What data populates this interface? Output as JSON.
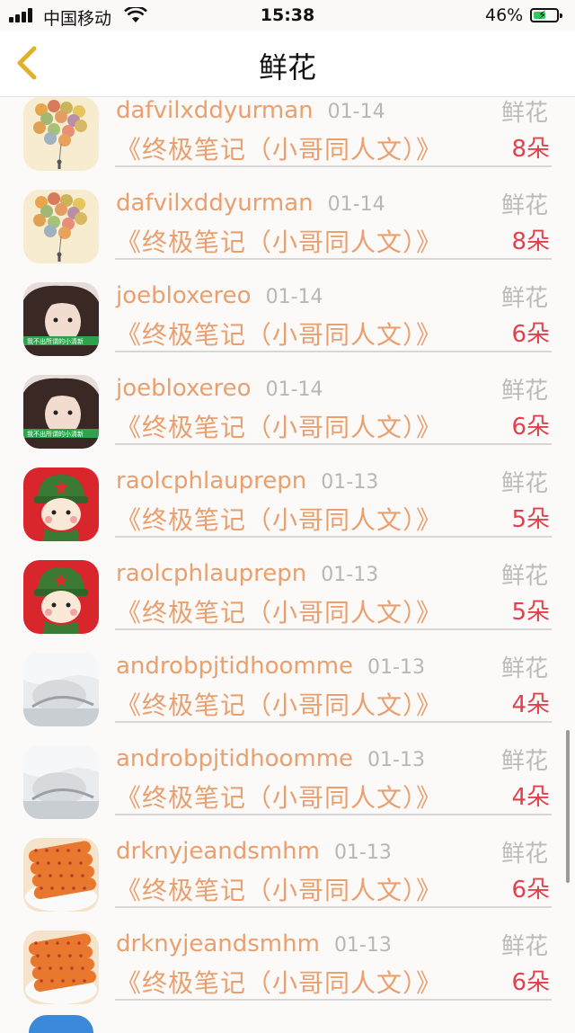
{
  "status_bar": {
    "carrier": "中国移动",
    "time": "15:38",
    "battery_percent": "46%"
  },
  "header": {
    "title": "鲜花"
  },
  "rows": [
    {
      "name": "dafvilxddyurman",
      "date": "01-14",
      "tag": "鲜花",
      "book": "《终极笔记（小哥同人文）》",
      "count": "8朵",
      "avatar": "balloons"
    },
    {
      "name": "dafvilxddyurman",
      "date": "01-14",
      "tag": "鲜花",
      "book": "《终极笔记（小哥同人文）》",
      "count": "8朵",
      "avatar": "balloons"
    },
    {
      "name": "joebloxereo",
      "date": "01-14",
      "tag": "鲜花",
      "book": "《终极笔记（小哥同人文）》",
      "count": "6朵",
      "avatar": "girl"
    },
    {
      "name": "joebloxereo",
      "date": "01-14",
      "tag": "鲜花",
      "book": "《终极笔记（小哥同人文）》",
      "count": "6朵",
      "avatar": "girl"
    },
    {
      "name": "raolcphlauprepn",
      "date": "01-13",
      "tag": "鲜花",
      "book": "《终极笔记（小哥同人文）》",
      "count": "5朵",
      "avatar": "soldier"
    },
    {
      "name": "raolcphlauprepn",
      "date": "01-13",
      "tag": "鲜花",
      "book": "《终极笔记（小哥同人文）》",
      "count": "5朵",
      "avatar": "soldier"
    },
    {
      "name": "androbpjtidhoomme",
      "date": "01-13",
      "tag": "鲜花",
      "book": "《终极笔记（小哥同人文）》",
      "count": "4朵",
      "avatar": "sleeping"
    },
    {
      "name": "androbpjtidhoomme",
      "date": "01-13",
      "tag": "鲜花",
      "book": "《终极笔记（小哥同人文）》",
      "count": "4朵",
      "avatar": "sleeping"
    },
    {
      "name": "drknyjeandsmhm",
      "date": "01-13",
      "tag": "鲜花",
      "book": "《终极笔记（小哥同人文）》",
      "count": "6朵",
      "avatar": "food"
    },
    {
      "name": "drknyjeandsmhm",
      "date": "01-13",
      "tag": "鲜花",
      "book": "《终极笔记（小哥同人文）》",
      "count": "6朵",
      "avatar": "food"
    }
  ],
  "colors": {
    "name": "#e8a06e",
    "count": "#e0414d",
    "muted": "#bcbaba",
    "back_arrow": "#e2b12a"
  }
}
